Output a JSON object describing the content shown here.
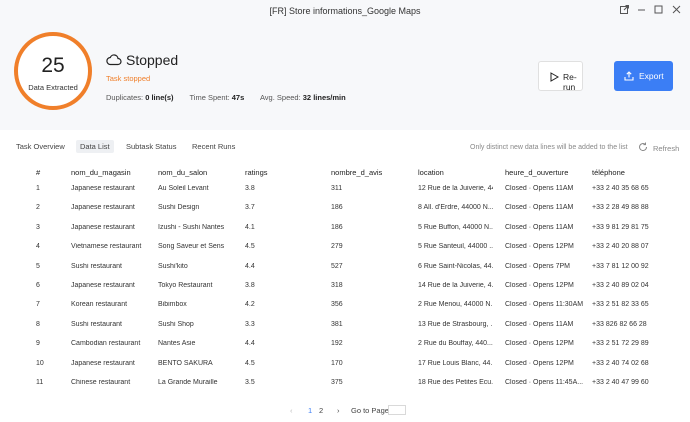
{
  "window": {
    "title": "[FR] Store informations_Google Maps",
    "controls": [
      "open-external-icon",
      "minimize-icon",
      "maximize-icon",
      "close-icon"
    ]
  },
  "summary": {
    "count": "25",
    "count_label": "Data Extracted",
    "accent_color": "#f07f2a",
    "status_icon": "cloud-icon",
    "status": "Stopped",
    "status_sub": "Task stopped",
    "duplicates_label": "Duplicates:",
    "duplicates_value": "0 line(s)",
    "time_label": "Time Spent:",
    "time_value": "47s",
    "speed_label": "Avg. Speed:",
    "speed_value": "32 lines/min"
  },
  "actions": {
    "rerun_label": "Re-run",
    "export_label": "Export",
    "export_color": "#3b7ef5"
  },
  "tabs": {
    "items": [
      "Task Overview",
      "Data List",
      "Subtask Status",
      "Recent Runs"
    ],
    "active": "Data List",
    "notice": "Only distinct new data lines will be added to the list",
    "refresh_label": "Refresh"
  },
  "table": {
    "headers": [
      "#",
      "nom_du_magasin",
      "nom_du_salon",
      "ratings",
      "nombre_d_avis",
      "location",
      "heure_d_ouverture",
      "téléphone"
    ],
    "rows": [
      [
        "1",
        "Japanese restaurant",
        "Au Soleil Levant",
        "3.8",
        "311",
        "12 Rue de la Juiverie, 44...",
        "Closed · Opens 11AM",
        "+33 2 40 35 68 65"
      ],
      [
        "2",
        "Japanese restaurant",
        "Sushi Design",
        "3.7",
        "186",
        "8 All. d'Erdre, 44000 N...",
        "Closed · Opens 11AM",
        "+33 2 28 49 88 88"
      ],
      [
        "3",
        "Japanese restaurant",
        "Izushi - Sushi Nantes",
        "4.1",
        "186",
        "5 Rue Buffon, 44000 N...",
        "Closed · Opens 11AM",
        "+33 9 81 29 81 75"
      ],
      [
        "4",
        "Vietnamese restaurant",
        "Song Saveur et Sens",
        "4.5",
        "279",
        "5 Rue Santeuil, 44000 ...",
        "Closed · Opens 12PM",
        "+33 2 40 20 88 07"
      ],
      [
        "5",
        "Sushi restaurant",
        "Sushi'kito",
        "4.4",
        "527",
        "6 Rue Saint-Nicolas, 44...",
        "Closed · Opens 7PM",
        "+33 7 81 12 00 92"
      ],
      [
        "6",
        "Japanese restaurant",
        "Tokyo Restaurant",
        "3.8",
        "318",
        "14 Rue de la Juiverie, 4...",
        "Closed · Opens 12PM",
        "+33 2 40 89 02 04"
      ],
      [
        "7",
        "Korean restaurant",
        "Bibimbox",
        "4.2",
        "356",
        "2 Rue Menou, 44000 N...",
        "Closed · Opens 11:30AM",
        "+33 2 51 82 33 65"
      ],
      [
        "8",
        "Sushi restaurant",
        "Sushi Shop",
        "3.3",
        "381",
        "13 Rue de Strasbourg, ...",
        "Closed · Opens 11AM",
        "+33 826 82 66 28"
      ],
      [
        "9",
        "Cambodian restaurant",
        "Nantes Asie",
        "4.4",
        "192",
        "2 Rue du Bouffay, 440...",
        "Closed · Opens 12PM",
        "+33 2 51 72 29 89"
      ],
      [
        "10",
        "Japanese restaurant",
        "BENTO SAKURA",
        "4.5",
        "170",
        "17 Rue Louis Blanc, 44...",
        "Closed · Opens 12PM",
        "+33 2 40 74 02 68"
      ],
      [
        "11",
        "Chinese restaurant",
        "La Grande Muraille",
        "3.5",
        "375",
        "18 Rue des Petites Écu...",
        "Closed · Opens 11:45A...",
        "+33 2 40 47 99 60"
      ]
    ]
  },
  "pagination": {
    "prev": "‹",
    "pages": [
      "1",
      "2"
    ],
    "current": "1",
    "next": "›",
    "goto_label": "Go to Page"
  }
}
